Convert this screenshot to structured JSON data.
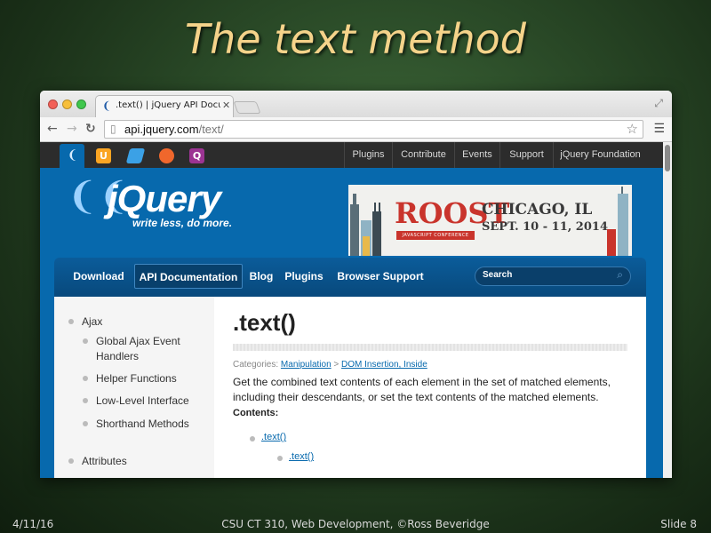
{
  "slide": {
    "title": "The text method",
    "footer_date": "4/11/16",
    "footer_center": "CSU CT 310, Web Development, ©Ross Beveridge",
    "footer_slide": "Slide 8"
  },
  "browser": {
    "tab_title": ".text() | jQuery API Documentation",
    "tab_close": "✕",
    "url_host": "api.jquery.com",
    "url_path": "/text/"
  },
  "site": {
    "topnav": [
      "Plugins",
      "Contribute",
      "Events",
      "Support",
      "jQuery Foundation"
    ],
    "project_icons": [
      {
        "name": "jquery-icon",
        "glyph": "❨"
      },
      {
        "name": "jquery-ui-icon",
        "glyph": "U"
      },
      {
        "name": "jquery-mobile-icon",
        "glyph": "▬"
      },
      {
        "name": "sizzle-icon",
        "glyph": "●"
      },
      {
        "name": "qunit-icon",
        "glyph": "Q"
      }
    ],
    "logo_text": "jQuery",
    "logo_tagline": "write less, do more.",
    "ad": {
      "title": "ROOST",
      "subtitle": "JAVASCRIPT CONFERENCE",
      "city": "CHICAGO, IL",
      "dates": "SEPT. 10 - 11, 2014"
    },
    "nav": [
      "Download",
      "API Documentation",
      "Blog",
      "Plugins",
      "Browser Support"
    ],
    "search_placeholder": "Search"
  },
  "sidebar": {
    "items": [
      {
        "label": "Ajax",
        "level": 0
      },
      {
        "label": "Global Ajax Event",
        "label2": "Handlers",
        "level": 1
      },
      {
        "label": "Helper Functions",
        "level": 1
      },
      {
        "label": "Low-Level Interface",
        "level": 1
      },
      {
        "label": "Shorthand Methods",
        "level": 1
      },
      {
        "label": "Attributes",
        "level": 0
      }
    ]
  },
  "entry": {
    "title": ".text()",
    "categories_prefix": "Categories: ",
    "category_1": "Manipulation",
    "category_sep": " > ",
    "category_2": "DOM Insertion, Inside",
    "description": "Get the combined text contents of each element in the set of matched elements, including their descendants, or set the text contents of the matched elements.",
    "contents_label": "Contents:",
    "toc": [
      ".text()",
      ".text()"
    ]
  },
  "colors": {
    "brand_blue": "#0769ad",
    "title_gold": "#f5d38a",
    "roost_red": "#c9342c"
  }
}
